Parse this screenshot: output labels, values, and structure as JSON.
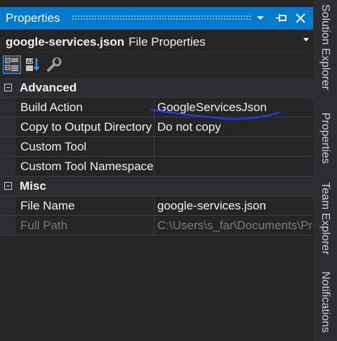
{
  "titlebar": {
    "title": "Properties"
  },
  "selector": {
    "object_name": "google-services.json",
    "object_type": "File Properties"
  },
  "toolbar": {
    "icons": [
      "categorized-icon",
      "alphabetical-icon",
      "property-pages-icon"
    ]
  },
  "categories": [
    {
      "label": "Advanced",
      "rows": [
        {
          "name": "Build Action",
          "value": "GoogleServicesJson"
        },
        {
          "name": "Copy to Output Directory",
          "value": "Do not copy"
        },
        {
          "name": "Custom Tool",
          "value": ""
        },
        {
          "name": "Custom Tool Namespace",
          "value": ""
        }
      ]
    },
    {
      "label": "Misc",
      "rows": [
        {
          "name": "File Name",
          "value": "google-services.json"
        },
        {
          "name": "Full Path",
          "value": "C:\\Users\\s_far\\Documents\\Projects"
        }
      ]
    }
  ],
  "side_tabs": [
    "Solution Explorer",
    "Properties",
    "Team Explorer",
    "Notifications"
  ],
  "colors": {
    "accent": "#007acc",
    "background": "#252526",
    "ink": "#1a3fff"
  }
}
